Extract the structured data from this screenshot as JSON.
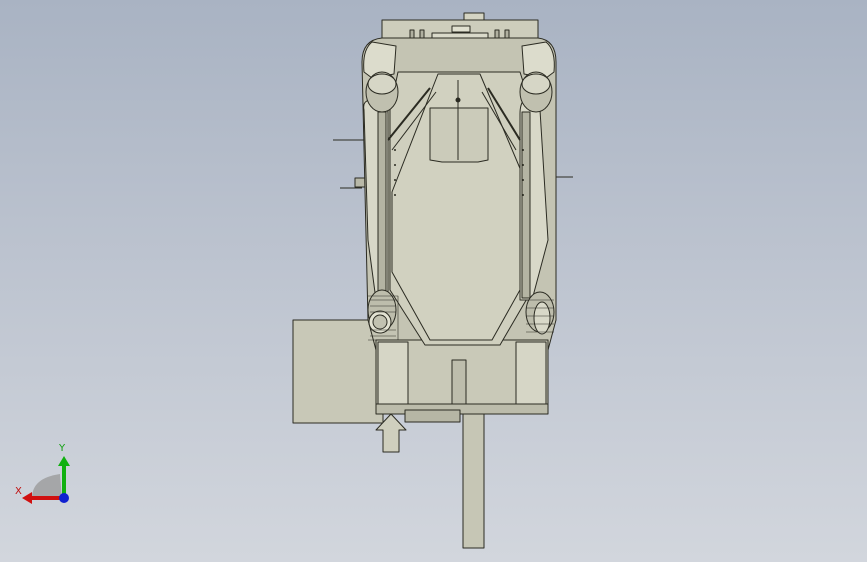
{
  "viewport": {
    "background_top": "#a9b3c3",
    "background_bottom": "#d2d6dd"
  },
  "model": {
    "body_fill": "#c9c9b8",
    "body_dark": "#a7a797",
    "edge_color": "#2b2b22",
    "light_fill": "#d8d8c8"
  },
  "triad": {
    "x_label": "X",
    "y_label": "Y",
    "x_color": "#d01010",
    "y_color": "#10b010",
    "z_color": "#1020d0"
  }
}
